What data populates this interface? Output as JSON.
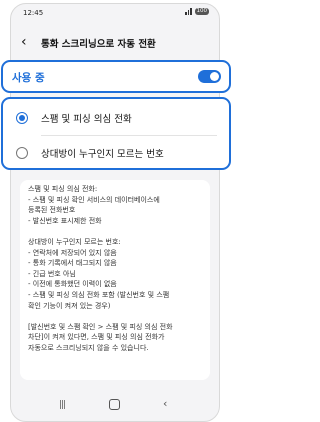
{
  "status_bar": {
    "time": "12:45",
    "battery": "100"
  },
  "header": {
    "back_icon": "‹",
    "title": "통화 스크리닝으로 자동 전환"
  },
  "use_toggle": {
    "label": "사용 중",
    "state": "on",
    "accent": "#1f6fd9"
  },
  "options": [
    {
      "label": "스팸 및 피싱 의심 전화",
      "selected": true
    },
    {
      "label": "상대방이 누구인지 모르는 번호",
      "selected": false
    }
  ],
  "description": {
    "lines": [
      "스팸 및 피싱 의심 전화:",
      "- 스팸 및 피싱 확인 서비스의 데이터베이스에",
      "  등록된 전화번호",
      "- 발신번호 표시제한 전화",
      "",
      "상대방이 누구인지 모르는 번호:",
      "- 연락처에 저장되어 있지 않음",
      "- 통화 기록에서 태그되지 않음",
      "- 긴급 번호 아님",
      "- 이전에 통화했던 이력이 없음",
      "- 스팸 및 피싱 의심 전화 포함 (발신번호 및 스팸",
      "  확인 기능이 켜져 있는 경우)",
      "",
      "[발신번호 및 스팸 확인 > 스팸 및 피싱 의심 전화",
      "차단]이 켜져 있다면, 스팸 및 피싱 의심 전화가",
      "자동으로 스크리닝되지 않을 수 있습니다."
    ]
  },
  "navbar": {
    "recent": "|||",
    "back": "‹"
  }
}
